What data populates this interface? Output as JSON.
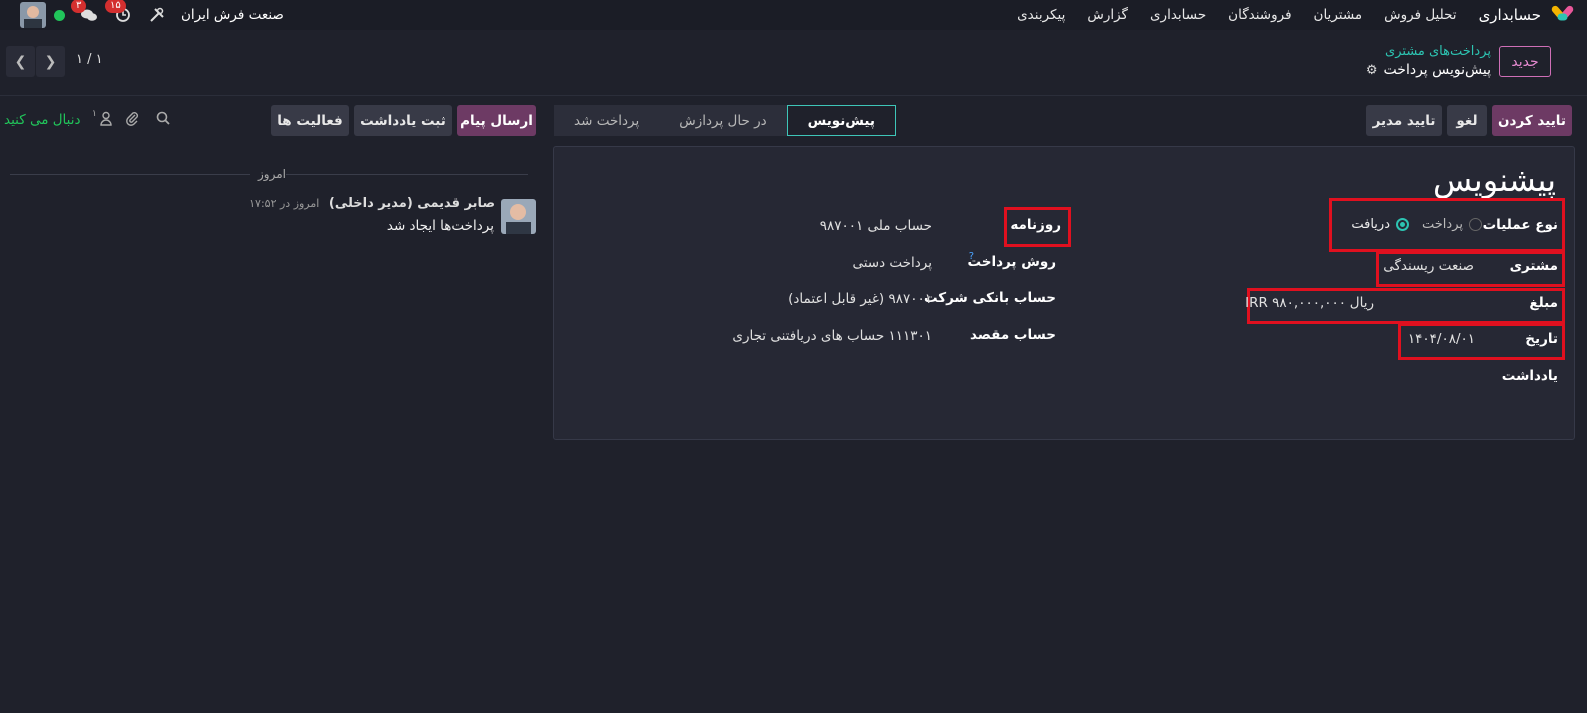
{
  "navbar": {
    "app_name": "حسابداری",
    "menu": [
      "تحلیل فروش",
      "مشتریان",
      "فروشندگان",
      "حسابداری",
      "گزارش",
      "پیکربندی"
    ],
    "company": "صنعت فرش ایران",
    "activity_badge": "۱۵",
    "messages_badge": "۳"
  },
  "control": {
    "new_label": "جدید",
    "breadcrumb_parent": "پرداخت‌های مشتری",
    "breadcrumb_current": "پیش‌نویس پرداخت",
    "pager": "۱ / ۱"
  },
  "actions": {
    "confirm": "تایید کردن",
    "cancel": "لغو",
    "manager_approve": "تایید مدیر"
  },
  "stages": [
    "پیش‌نویس",
    "در حال پردازش",
    "پرداخت شد"
  ],
  "form": {
    "title": "پیشنویس",
    "operation_type_label": "نوع عملیات",
    "operation_options": [
      "دریافت",
      "پرداخت"
    ],
    "customer_label": "مشتری",
    "customer_value": "صنعت ریسندگی",
    "amount_label": "مبلغ",
    "amount_currency": "ریال",
    "amount_value": "IRR ۹۸۰,۰۰۰,۰۰۰",
    "date_label": "تاریخ",
    "date_value": "۱۴۰۴/۰۸/۰۱",
    "memo_label": "یادداشت",
    "journal_label": "روزنامه",
    "journal_value": "حساب ملی ۹۸۷۰۰۱",
    "payment_method_label": "روش پرداخت",
    "payment_method_help": "?",
    "payment_method_value": "پرداخت دستی",
    "company_bank_label": "حساب بانکی شرکت",
    "company_bank_value": "۹۸۷۰۰۱ (غیر قابل اعتماد)",
    "destination_label": "حساب مقصد",
    "destination_value": "۱۱۱۳۰۱ حساب های دریافتنی تجاری"
  },
  "chatter": {
    "send_message": "ارسال پیام",
    "log_note": "ثبت یادداشت",
    "activities": "فعالیت ها",
    "follow": "دنبال می کنید",
    "followers_count": "۱",
    "today": "امروز",
    "author": "صابر قدیمی (مدیر داخلی)",
    "time": "امروز در ۱۷:۵۲",
    "body": "پرداخت‌ها ایجاد شد"
  },
  "colors": {
    "primary": "#6d3a64",
    "accent_teal": "#2dc4b2",
    "highlight_red": "#e0101f",
    "follow_green": "#21c45a"
  }
}
